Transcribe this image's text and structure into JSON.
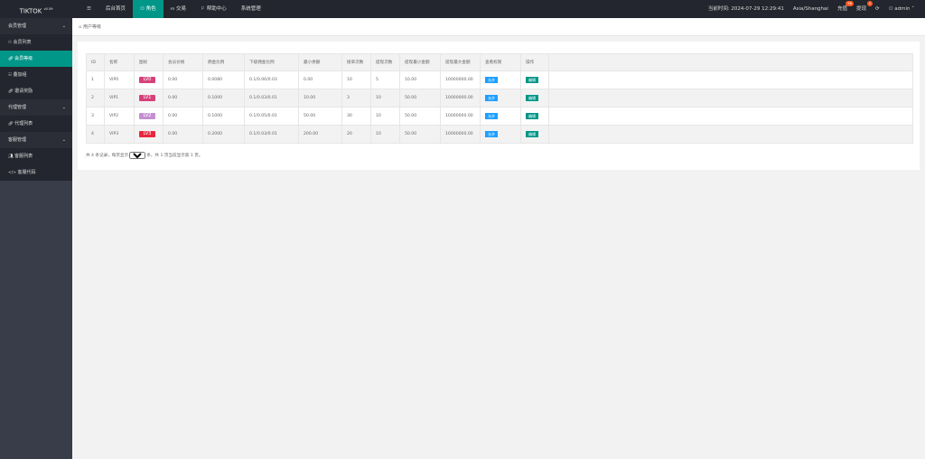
{
  "header": {
    "logo": "TIKTOK",
    "version": "v5.59",
    "nav": [
      "☰",
      "后台首页",
      "角色",
      "交易",
      "帮助中心",
      "系统管理"
    ],
    "nav_icons": [
      "menu-icon",
      "",
      "user-icon",
      "exchange-icon",
      "flag-icon",
      ""
    ],
    "time": "当前时间: 2024-07-29 12:29:41",
    "timezone": "Asia/Shanghai",
    "recharge": "充值",
    "recharge_badge": "56",
    "withdraw": "提现",
    "withdraw_badge": "5",
    "refresh": "⟳",
    "user": "admin"
  },
  "sidebar": {
    "items": [
      {
        "label": "会员管理",
        "type": "group"
      },
      {
        "label": "会员列表",
        "type": "item",
        "icon": "user-icon"
      },
      {
        "label": "会员等级",
        "type": "item",
        "icon": "link-icon",
        "active": true
      },
      {
        "label": "叠加组",
        "type": "item",
        "icon": "grid-icon"
      },
      {
        "label": "邀请奖励",
        "type": "item",
        "icon": "link-icon"
      },
      {
        "label": "代理管理",
        "type": "group"
      },
      {
        "label": "代理列表",
        "type": "item",
        "icon": "link-icon"
      },
      {
        "label": "客服管理",
        "type": "group"
      },
      {
        "label": "客服列表",
        "type": "item",
        "icon": "users-icon"
      },
      {
        "label": "客服代码",
        "type": "item",
        "icon": "code-icon"
      }
    ]
  },
  "breadcrumb": "用户等级",
  "table": {
    "headers": [
      "ID",
      "名称",
      "图标",
      "会员价格",
      "佣金比例",
      "下级佣金比例",
      "最小余额",
      "接单次数",
      "提现次数",
      "提现最小金额",
      "提现最大金额",
      "查看权限",
      "操作"
    ],
    "rows": [
      [
        "1",
        "VIP0",
        "LV0",
        "0.00",
        "0.0080",
        "0.1/0.06/0.03",
        "0.00",
        "10",
        "5",
        "10.00",
        "10000000.00",
        "允许",
        "编辑"
      ],
      [
        "2",
        "VIP1",
        "LV1",
        "0.00",
        "0.1000",
        "0.1/0.03/0.01",
        "10.00",
        "3",
        "10",
        "50.00",
        "10000000.00",
        "允许",
        "编辑"
      ],
      [
        "3",
        "VIP2",
        "LV2",
        "0.00",
        "0.1000",
        "0.1/0.05/0.01",
        "50.00",
        "30",
        "10",
        "50.00",
        "10000000.00",
        "允许",
        "编辑"
      ],
      [
        "4",
        "VIP3",
        "LV3",
        "0.00",
        "0.2000",
        "0.1/0.03/0.01",
        "200.00",
        "20",
        "10",
        "50.00",
        "10000000.00",
        "允许",
        "编辑"
      ]
    ]
  },
  "pager": {
    "prefix": "共 4 条记录，每页显示",
    "per_page": "20",
    "suffix": "条，共 1 页当前显示第 1 页。"
  },
  "colors": {
    "accent": "#009688",
    "allow": "#1e9fff",
    "badge": "#ff5722",
    "lv": [
      "#d6417a",
      "#d6417a",
      "#c48fd0",
      "#e8273f"
    ]
  }
}
